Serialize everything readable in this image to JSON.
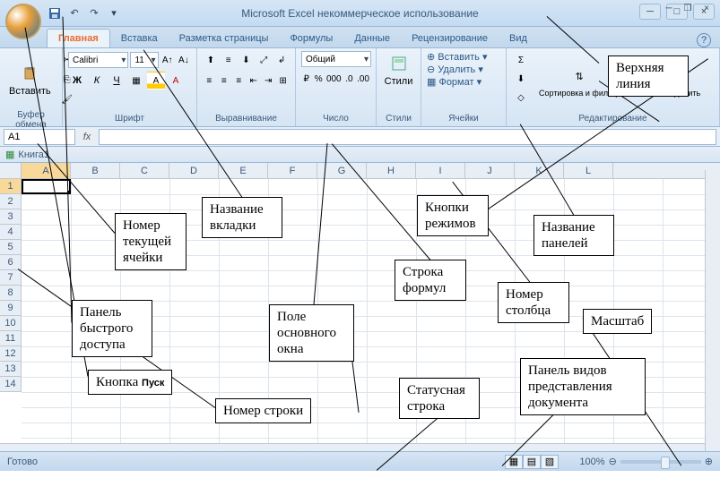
{
  "title": "Microsoft Excel некоммерческое использование",
  "tabs": [
    "Главная",
    "Вставка",
    "Разметка страницы",
    "Формулы",
    "Данные",
    "Рецензирование",
    "Вид"
  ],
  "active_tab": 0,
  "groups": {
    "clipboard": "Буфер обмена",
    "font": "Шрифт",
    "alignment": "Выравнивание",
    "number": "Число",
    "styles": "Стили",
    "cells": "Ячейки",
    "editing": "Редактирование"
  },
  "paste": "Вставить",
  "font_name": "Calibri",
  "font_size": "11",
  "number_format": "Общий",
  "styles_btn": "Стили",
  "cells_menu": {
    "insert": "Вставить",
    "delete": "Удалить",
    "format": "Формат"
  },
  "edit": {
    "sort": "Сортировка и фильтр",
    "find": "Найти и выделить"
  },
  "namebox": "A1",
  "fx": "fx",
  "bookname": "Книга1",
  "columns": [
    "A",
    "B",
    "C",
    "D",
    "E",
    "F",
    "G",
    "H",
    "I",
    "J",
    "K",
    "L"
  ],
  "rows": [
    "1",
    "2",
    "3",
    "4",
    "5",
    "6",
    "7",
    "8",
    "9",
    "10",
    "11",
    "12",
    "13",
    "14"
  ],
  "status": "Готово",
  "zoom": "100%",
  "callouts": {
    "c1": "Верхняя линия",
    "c2": "Название вкладки",
    "c3": "Кнопки режимов",
    "c4": "Название панелей",
    "c5": "Номер текущей ячейки",
    "c6": "Панель быстрого доступа",
    "c7": "Кнопка Пуск",
    "c8": "Номер строки",
    "c9": "Поле основного окна",
    "c10": "Строка формул",
    "c11": "Статусная строка",
    "c12": "Номер столбца",
    "c13": "Масштаб",
    "c14": "Панель видов представления документа"
  }
}
